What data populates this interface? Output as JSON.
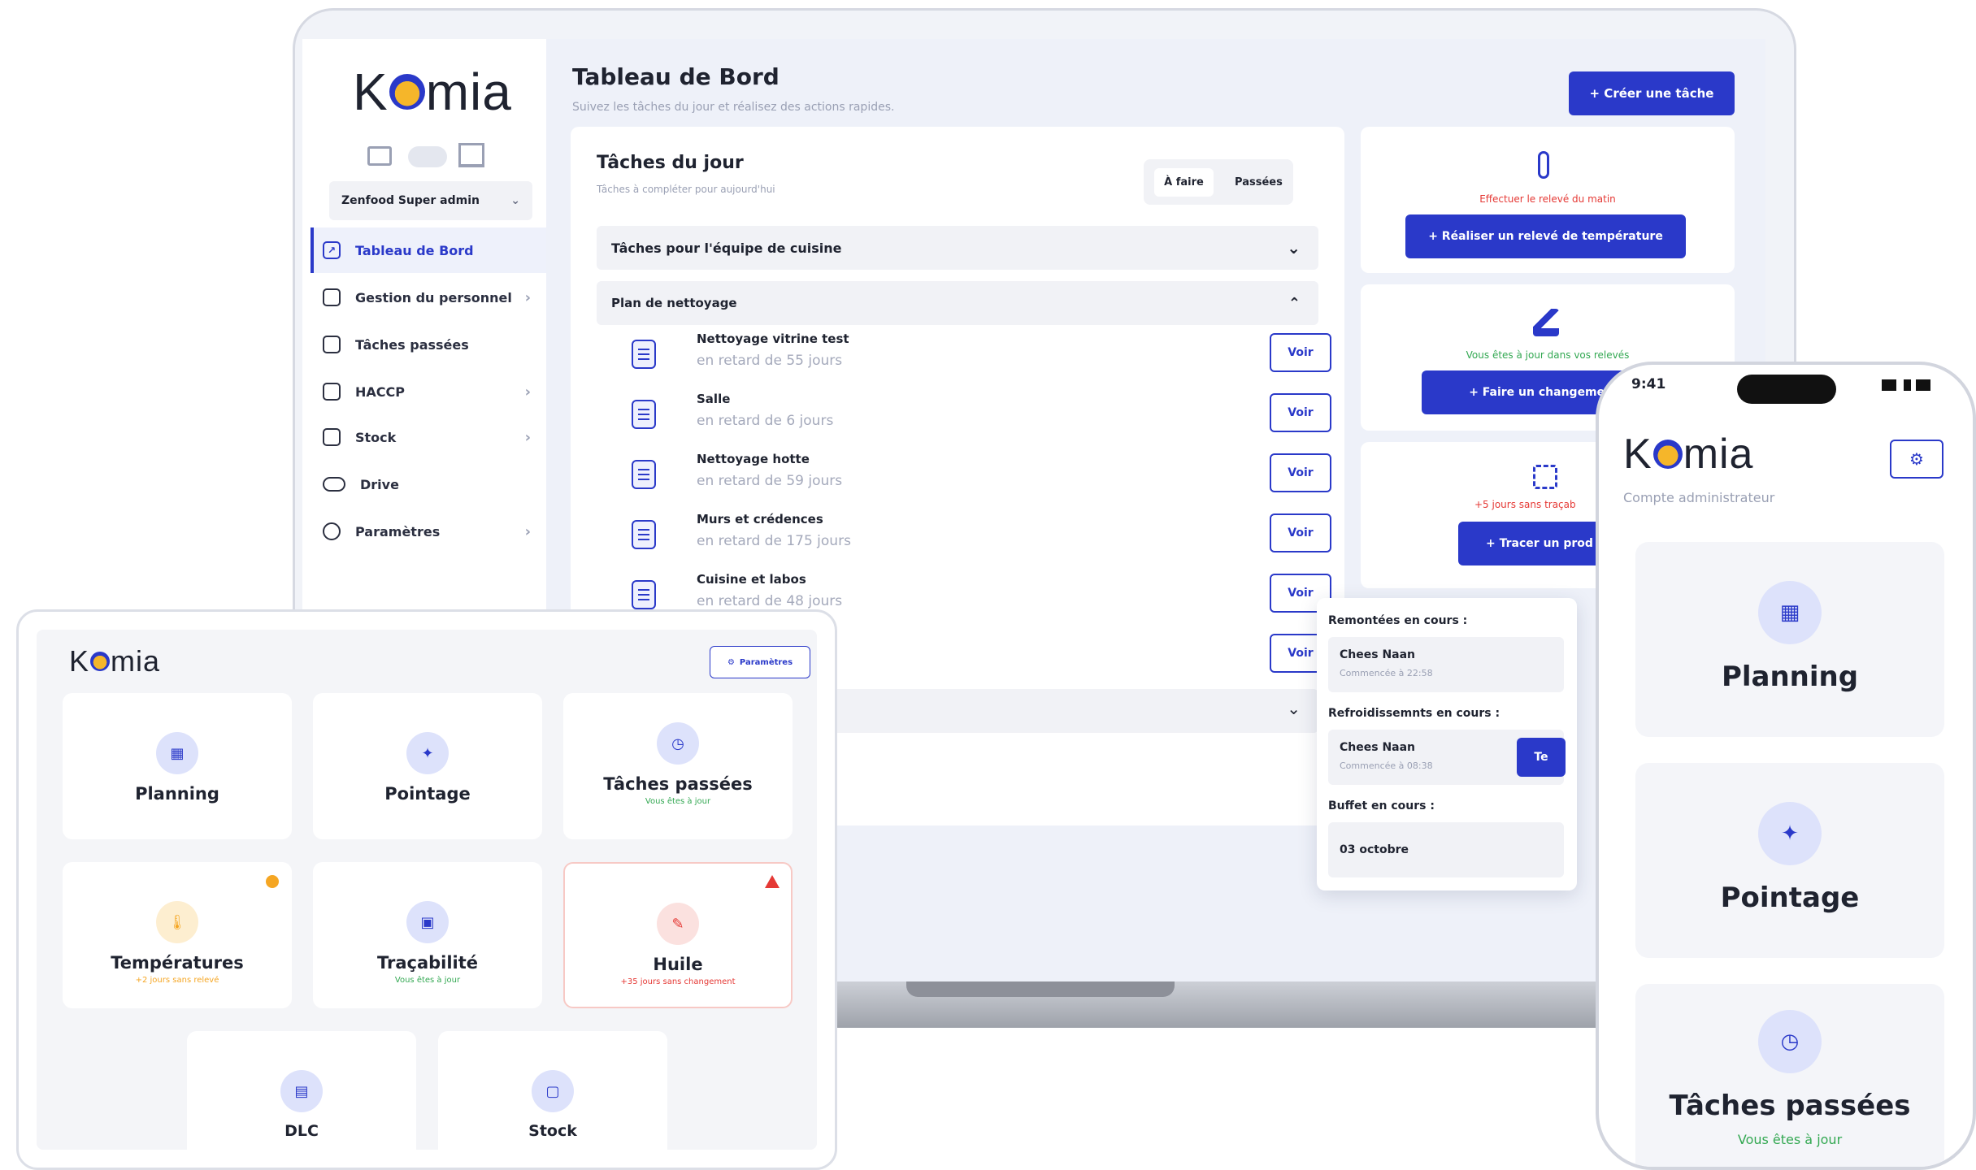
{
  "laptop": {
    "brand": "Komia",
    "account_selector": "Zenfood Super admin",
    "nav": [
      {
        "label": "Tableau de Bord",
        "icon": "chart-icon"
      },
      {
        "label": "Gestion du personnel",
        "icon": "calendar-icon"
      },
      {
        "label": "Tâches passées",
        "icon": "clock-icon"
      },
      {
        "label": "HACCP",
        "icon": "clipboard-icon"
      },
      {
        "label": "Stock",
        "icon": "box-icon"
      },
      {
        "label": "Drive",
        "icon": "cloud-icon"
      },
      {
        "label": "Paramètres",
        "icon": "gear-icon"
      }
    ],
    "header": {
      "title": "Tableau de Bord",
      "subtitle": "Suivez les tâches du jour et réalisez des actions rapides.",
      "create_button": "+ Créer une tâche"
    },
    "tasks_panel": {
      "title": "Tâches du jour",
      "subtitle": "Tâches à compléter pour aujourd'hui",
      "tab_todo": "À faire",
      "tab_past": "Passées",
      "group_kitchen": "Tâches pour l'équipe de cuisine",
      "group_cleaning": "Plan de nettoyage",
      "items": [
        {
          "title": "Nettoyage vitrine test",
          "status": "en retard de 55 jours"
        },
        {
          "title": "Salle",
          "status": "en retard de 6 jours"
        },
        {
          "title": "Nettoyage hotte",
          "status": "en retard de 59 jours"
        },
        {
          "title": "Murs et crédences",
          "status": "en retard de 175 jours"
        },
        {
          "title": "Cuisine et labos",
          "status": "en retard de 48 jours"
        }
      ],
      "voir_label": "Voir"
    },
    "actions": [
      {
        "status": "Effectuer le relevé du matin",
        "button": "+ Réaliser un relevé de température",
        "status_color": "#e53935"
      },
      {
        "status": "Vous êtes à jour dans vos relevés",
        "button": "+ Faire un changement",
        "status_color": "#33a852"
      },
      {
        "status": "+5 jours sans traçab",
        "button": "+ Tracer un prod",
        "status_color": "#e53935"
      }
    ],
    "popup": {
      "remontees_label": "Remontées en cours :",
      "remontees_name": "Chees Naan",
      "remontees_time": "Commencée à 22:58",
      "refroid_label": "Refroidissemnts en cours :",
      "refroid_name": "Chees Naan",
      "refroid_time": "Commencée à 08:38",
      "refroid_button": "Te",
      "buffet_label": "Buffet en cours :",
      "buffet_value": "03 octobre"
    }
  },
  "tablet": {
    "brand": "Komia",
    "settings_button": "Paramètres",
    "cards": [
      {
        "label": "Planning",
        "sub": "",
        "icon": "calendar-icon"
      },
      {
        "label": "Pointage",
        "sub": "",
        "icon": "pin-icon"
      },
      {
        "label": "Tâches passées",
        "sub": "Vous êtes à jour",
        "icon": "clock-icon"
      },
      {
        "label": "Températures",
        "sub": "+2 jours sans relevé",
        "icon": "thermometer-icon"
      },
      {
        "label": "Traçabilité",
        "sub": "Vous êtes à jour",
        "icon": "tag-icon"
      },
      {
        "label": "Huile",
        "sub": "+35 jours sans changement",
        "icon": "brush-icon"
      },
      {
        "label": "DLC",
        "sub": "",
        "icon": "document-icon"
      },
      {
        "label": "Stock",
        "sub": "",
        "icon": "box-icon"
      }
    ]
  },
  "phone": {
    "time": "9:41",
    "brand": "Komia",
    "account": "Compte administrateur",
    "cards": [
      {
        "label": "Planning",
        "sub": ""
      },
      {
        "label": "Pointage",
        "sub": ""
      },
      {
        "label": "Tâches passées",
        "sub": "Vous êtes à jour"
      }
    ]
  }
}
